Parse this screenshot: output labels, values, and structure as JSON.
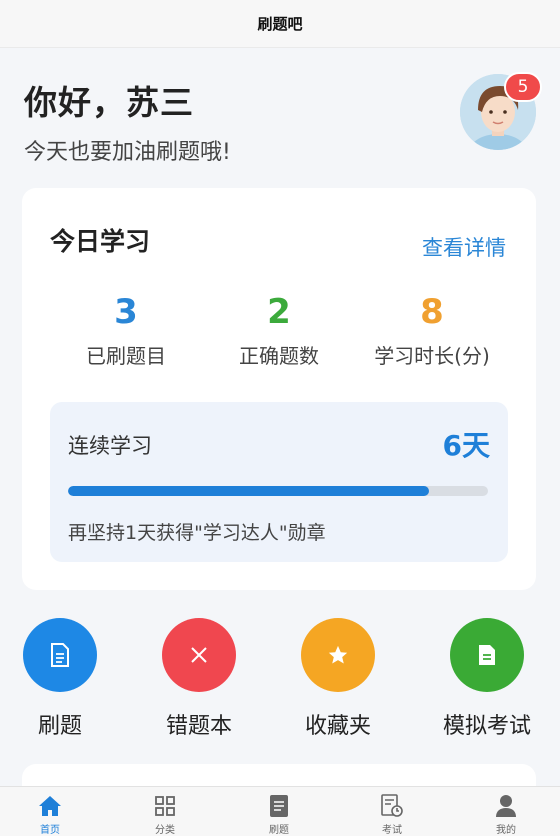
{
  "header": {
    "title": "刷题吧"
  },
  "greeting": {
    "hello": "你好，苏三",
    "subtitle": "今天也要加油刷题哦!",
    "notification_count": "5"
  },
  "today": {
    "title": "今日学习",
    "detail_link": "查看详情",
    "stats": [
      {
        "value": "3",
        "label": "已刷题目",
        "color": "#2a86d6"
      },
      {
        "value": "2",
        "label": "正确题数",
        "color": "#3caa3c"
      },
      {
        "value": "8",
        "label": "学习时长(分)",
        "color": "#f0a030"
      }
    ],
    "streak": {
      "label": "连续学习",
      "value": "6天",
      "progress": 0.86,
      "tip": "再坚持1天获得\"学习达人\"勋章"
    }
  },
  "actions": [
    {
      "label": "刷题",
      "color": "#1e88e5",
      "icon": "document-icon"
    },
    {
      "label": "错题本",
      "color": "#f0474f",
      "icon": "close-icon"
    },
    {
      "label": "收藏夹",
      "color": "#f5a623",
      "icon": "star-icon"
    },
    {
      "label": "模拟考试",
      "color": "#3aaa35",
      "icon": "exam-doc-icon"
    }
  ],
  "tabbar": [
    {
      "label": "首页",
      "icon": "home-icon",
      "active": true
    },
    {
      "label": "分类",
      "icon": "grid-icon",
      "active": false
    },
    {
      "label": "刷题",
      "icon": "document-icon",
      "active": false
    },
    {
      "label": "考试",
      "icon": "exam-clock-icon",
      "active": false
    },
    {
      "label": "我的",
      "icon": "user-icon",
      "active": false
    }
  ],
  "colors": {
    "accent": "#1e7fd8",
    "badge": "#f04a4a",
    "background": "#f4f6f9"
  }
}
